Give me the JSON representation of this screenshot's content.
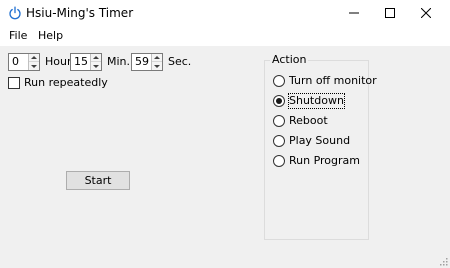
{
  "window": {
    "title": "Hsiu-Ming's Timer",
    "icon": "power-icon"
  },
  "menu": {
    "file": "File",
    "help": "Help"
  },
  "timer": {
    "hours": "0",
    "hour_label": "Hour",
    "minutes": "15",
    "minute_label": "Min.",
    "seconds": "59",
    "second_label": "Sec."
  },
  "options": {
    "run_repeatedly_label": "Run repeatedly",
    "run_repeatedly_checked": false
  },
  "start_label": "Start",
  "action": {
    "title": "Action",
    "options": [
      {
        "label": "Turn off monitor",
        "selected": false
      },
      {
        "label": "Shutdown",
        "selected": true
      },
      {
        "label": "Reboot",
        "selected": false
      },
      {
        "label": "Play Sound",
        "selected": false
      },
      {
        "label": "Run Program",
        "selected": false
      }
    ]
  }
}
